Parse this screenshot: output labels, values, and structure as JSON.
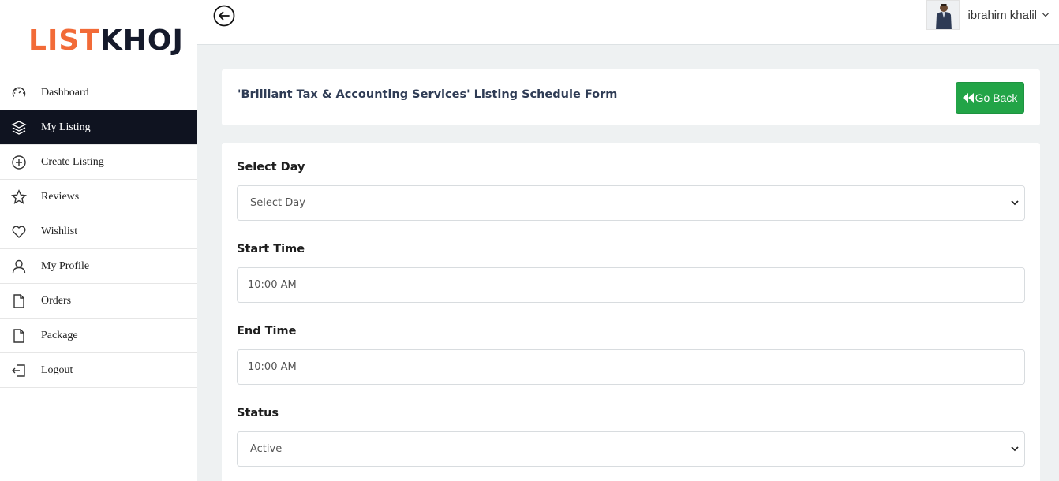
{
  "brand": {
    "part1": "LIST",
    "part2": "KHOJ",
    "color1": "#f26b38",
    "color2": "#151a2b"
  },
  "sidebar": {
    "items": [
      {
        "label": "Dashboard",
        "icon": "dashboard-gauge-icon",
        "active": false
      },
      {
        "label": "My Listing",
        "icon": "layers-icon",
        "active": true
      },
      {
        "label": "Create Listing",
        "icon": "plus-circle-icon",
        "active": false
      },
      {
        "label": "Reviews",
        "icon": "star-icon",
        "active": false
      },
      {
        "label": "Wishlist",
        "icon": "heart-icon",
        "active": false
      },
      {
        "label": "My Profile",
        "icon": "user-icon",
        "active": false
      },
      {
        "label": "Orders",
        "icon": "file-icon",
        "active": false
      },
      {
        "label": "Package",
        "icon": "file-icon",
        "active": false
      },
      {
        "label": "Logout",
        "icon": "logout-icon",
        "active": false
      }
    ]
  },
  "topbar": {
    "back_icon": "arrow-left-circle-icon",
    "user_name": "ibrahim khalil"
  },
  "header": {
    "title": "'Brilliant Tax & Accounting Services' Listing Schedule Form",
    "go_back_label": "Go Back",
    "accent": "#22a447"
  },
  "form": {
    "select_day_label": "Select Day",
    "select_day_value": "Select Day",
    "start_time_label": "Start Time",
    "start_time_value": "10:00 AM",
    "end_time_label": "End Time",
    "end_time_value": "10:00 AM",
    "status_label": "Status",
    "status_value": "Active"
  }
}
